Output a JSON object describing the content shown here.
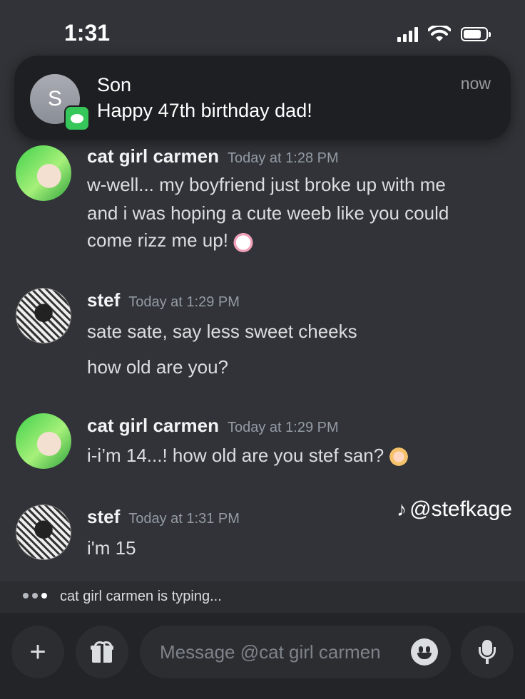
{
  "status_bar": {
    "time": "1:31"
  },
  "notification": {
    "avatar_letter": "S",
    "sender": "Son",
    "text": "Happy 47th birthday dad!",
    "time": "now"
  },
  "messages": [
    {
      "author": "cat girl carmen",
      "timestamp": "Today at 1:28 PM",
      "lines": [
        "w-well... my boyfriend just broke up with me",
        "and i was hoping a cute weeb like you could",
        "come rizz me up!"
      ]
    },
    {
      "author": "stef",
      "timestamp": "Today at 1:29 PM",
      "lines": [
        "sate sate, say less sweet cheeks",
        "how old are you?"
      ]
    },
    {
      "author": "cat girl carmen",
      "timestamp": "Today at 1:29 PM",
      "lines": [
        "i-i’m 14...! how old are you stef san?"
      ]
    },
    {
      "author": "stef",
      "timestamp": "Today at 1:31 PM",
      "lines": [
        "i'm 15"
      ]
    }
  ],
  "watermark": {
    "handle": "@stefkage",
    "icon": "tiktok-icon"
  },
  "typing_indicator": "cat girl carmen is typing...",
  "composer": {
    "plus_label": "+",
    "placeholder": "Message @cat girl carmen",
    "icons": [
      "plus-icon",
      "gift-icon",
      "smiley-icon",
      "microphone-icon"
    ]
  },
  "colors": {
    "background": "#313338",
    "notification_bg": "#1e1f22",
    "imessage_green": "#35c759",
    "composer_bg": "#232428"
  }
}
